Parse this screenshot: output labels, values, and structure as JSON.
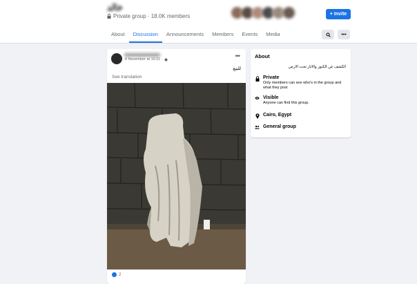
{
  "group": {
    "name": "خالد",
    "privacy": "Private group · 18.0K members"
  },
  "header": {
    "invite_label": "Invite",
    "avatar_colors": [
      "#8a6a58",
      "#5a4a42",
      "#b08a7a",
      "#4a4a4a",
      "#9a8a7a",
      "#6a5a52"
    ]
  },
  "tabs": [
    "About",
    "Discussion",
    "Announcements",
    "Members",
    "Events",
    "Media"
  ],
  "post": {
    "timestamp": "8 November at 10:21 ·",
    "text": "للبيع",
    "see_translation": "See translation",
    "reaction_count": "2"
  },
  "about": {
    "title": "About",
    "description": "الكشف عن الكنوز والاثار تحت الارض",
    "private_title": "Private",
    "private_desc": "Only members can see who's in the group and what they post",
    "visible_title": "Visible",
    "visible_desc": "Anyone can find this group.",
    "location": "Cairo, Egypt",
    "group_type": "General group"
  }
}
